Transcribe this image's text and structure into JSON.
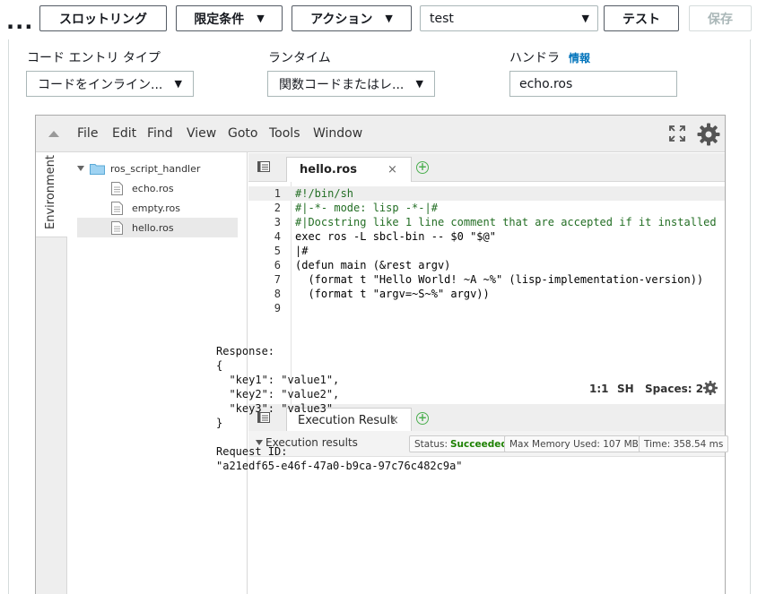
{
  "toolbar": {
    "dots": "...",
    "throttle_label": "スロットリング",
    "qualifier_label": "限定条件",
    "actions_label": "アクション",
    "test_event_value": "test",
    "test_label": "テスト",
    "save_label": "保存"
  },
  "config": {
    "code_entry_type_label": "コード エントリ タイプ",
    "code_entry_type_value": "コードをインライン...",
    "runtime_label": "ランタイム",
    "runtime_value": "関数コードまたはレ...",
    "handler_label": "ハンドラ",
    "handler_info": "情報",
    "handler_value": "echo.ros"
  },
  "ide": {
    "menu": [
      "File",
      "Edit",
      "Find",
      "View",
      "Goto",
      "Tools",
      "Window"
    ],
    "environment_label": "Environment",
    "tree": {
      "folder": "ros_script_handler",
      "files": [
        "echo.ros",
        "empty.ros",
        "hello.ros"
      ],
      "selected": "hello.ros"
    },
    "editor_tab": "hello.ros",
    "code_lines": [
      "#!/bin/sh",
      "#|-*- mode: lisp -*-|#",
      "#|Docstring like 1 line comment that are accepted if it installed",
      "exec ros -L sbcl-bin -- $0 \"$@\"",
      "|#",
      "(defun main (&rest argv)",
      "  (format t \"Hello World! ~A ~%\" (lisp-implementation-version))",
      "  (format t \"argv=~S~%\" argv))",
      ""
    ],
    "line_numbers": [
      "1",
      "2",
      "3",
      "4",
      "5",
      "6",
      "7",
      "8",
      "9"
    ],
    "status": {
      "cursor": "1:1",
      "mode": "SH",
      "spaces": "Spaces: 2"
    },
    "result_tab": "Execution Result",
    "execution": {
      "title": "Execution results",
      "status_label": "Status:",
      "status_value": "Succeeded",
      "memory": "Max Memory Used: 107 MB",
      "time": "Time: 358.54 ms",
      "output": "Response:\n{\n  \"key1\": \"value1\",\n  \"key2\": \"value2\",\n  \"key3\": \"value3\"\n}\n\nRequest ID:\n\"a21edf65-e46f-47a0-b9ca-97c76c482c9a\""
    }
  },
  "colors": {
    "accent_link": "#0073bb",
    "success": "#1d8102",
    "comment": "#236e24",
    "string": "#1a1aa6"
  }
}
